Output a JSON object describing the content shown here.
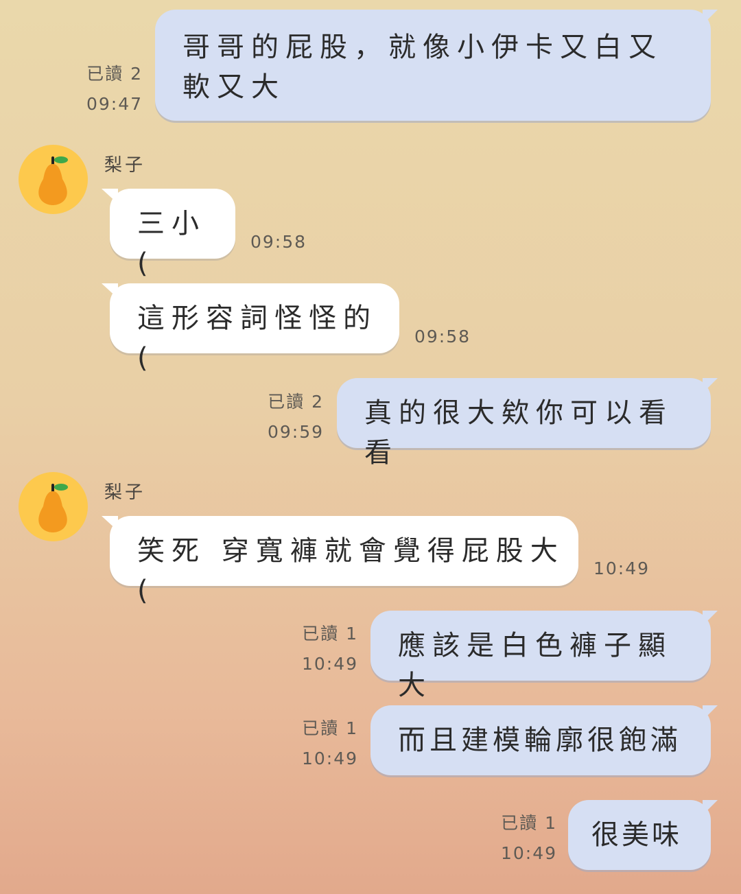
{
  "messages": [
    {
      "text": "哥哥的屁股，就像小伊卡又白又軟又大",
      "read": "已讀 2",
      "time": "09:47"
    },
    {
      "sender": "梨子",
      "text": "三小(",
      "time": "09:58"
    },
    {
      "text": "這形容詞怪怪的(",
      "time": "09:58"
    },
    {
      "text": "真的很大欸你可以看看",
      "read": "已讀 2",
      "time": "09:59"
    },
    {
      "sender": "梨子",
      "text": "笑死 穿寬褲就會覺得屁股大(",
      "time": "10:49"
    },
    {
      "text": "應該是白色褲子顯大",
      "read": "已讀 1",
      "time": "10:49"
    },
    {
      "text": "而且建模輪廓很飽滿",
      "read": "已讀 1",
      "time": "10:49"
    },
    {
      "text": "很美味",
      "read": "已讀 1",
      "time": "10:49"
    }
  ],
  "colors": {
    "outgoing_bubble": "#d6dff3",
    "incoming_bubble": "#ffffff",
    "avatar_bg": "#fdc94d",
    "pear": "#f39a1f",
    "leaf": "#3fa84a"
  },
  "avatar_icon": "pear-icon"
}
